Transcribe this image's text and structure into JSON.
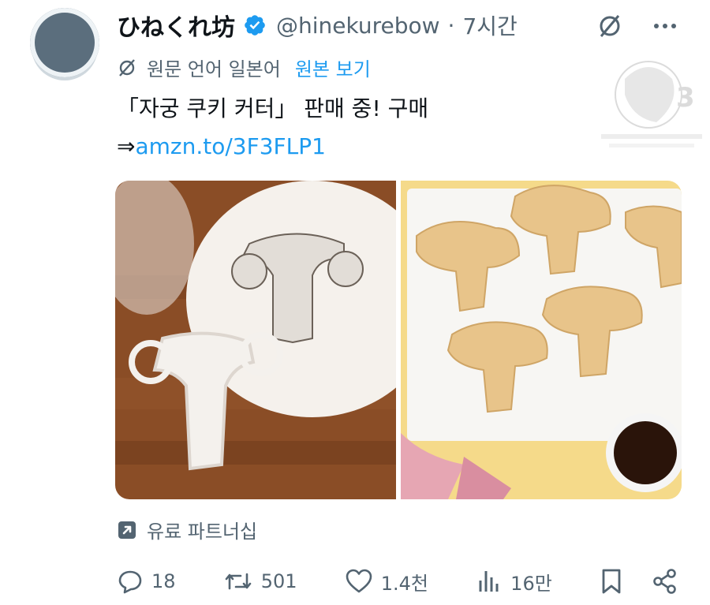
{
  "author": {
    "display_name": "ひねくれ坊",
    "handle": "@hinekurebow",
    "separator": "·",
    "time": "7시간"
  },
  "translation": {
    "label": "원문 언어 일본어",
    "show_original": "원본 보기"
  },
  "tweet": {
    "line1": "「자궁 쿠키 커터」 판매 중! 구매",
    "arrow": "⇒",
    "link": "amzn.to/3F3FLP1"
  },
  "partnership": "유료 파트너십",
  "actions": {
    "replies": "18",
    "retweets": "501",
    "likes": "1.4천",
    "views": "16만"
  },
  "colors": {
    "accent": "#1d9bf0",
    "secondary_text": "#536471",
    "primary_text": "#0f1419"
  },
  "icons": [
    "verified-icon",
    "translate-icon",
    "more-icon",
    "reply-icon",
    "retweet-icon",
    "like-icon",
    "views-icon",
    "bookmark-icon",
    "share-icon",
    "external-link-icon"
  ]
}
